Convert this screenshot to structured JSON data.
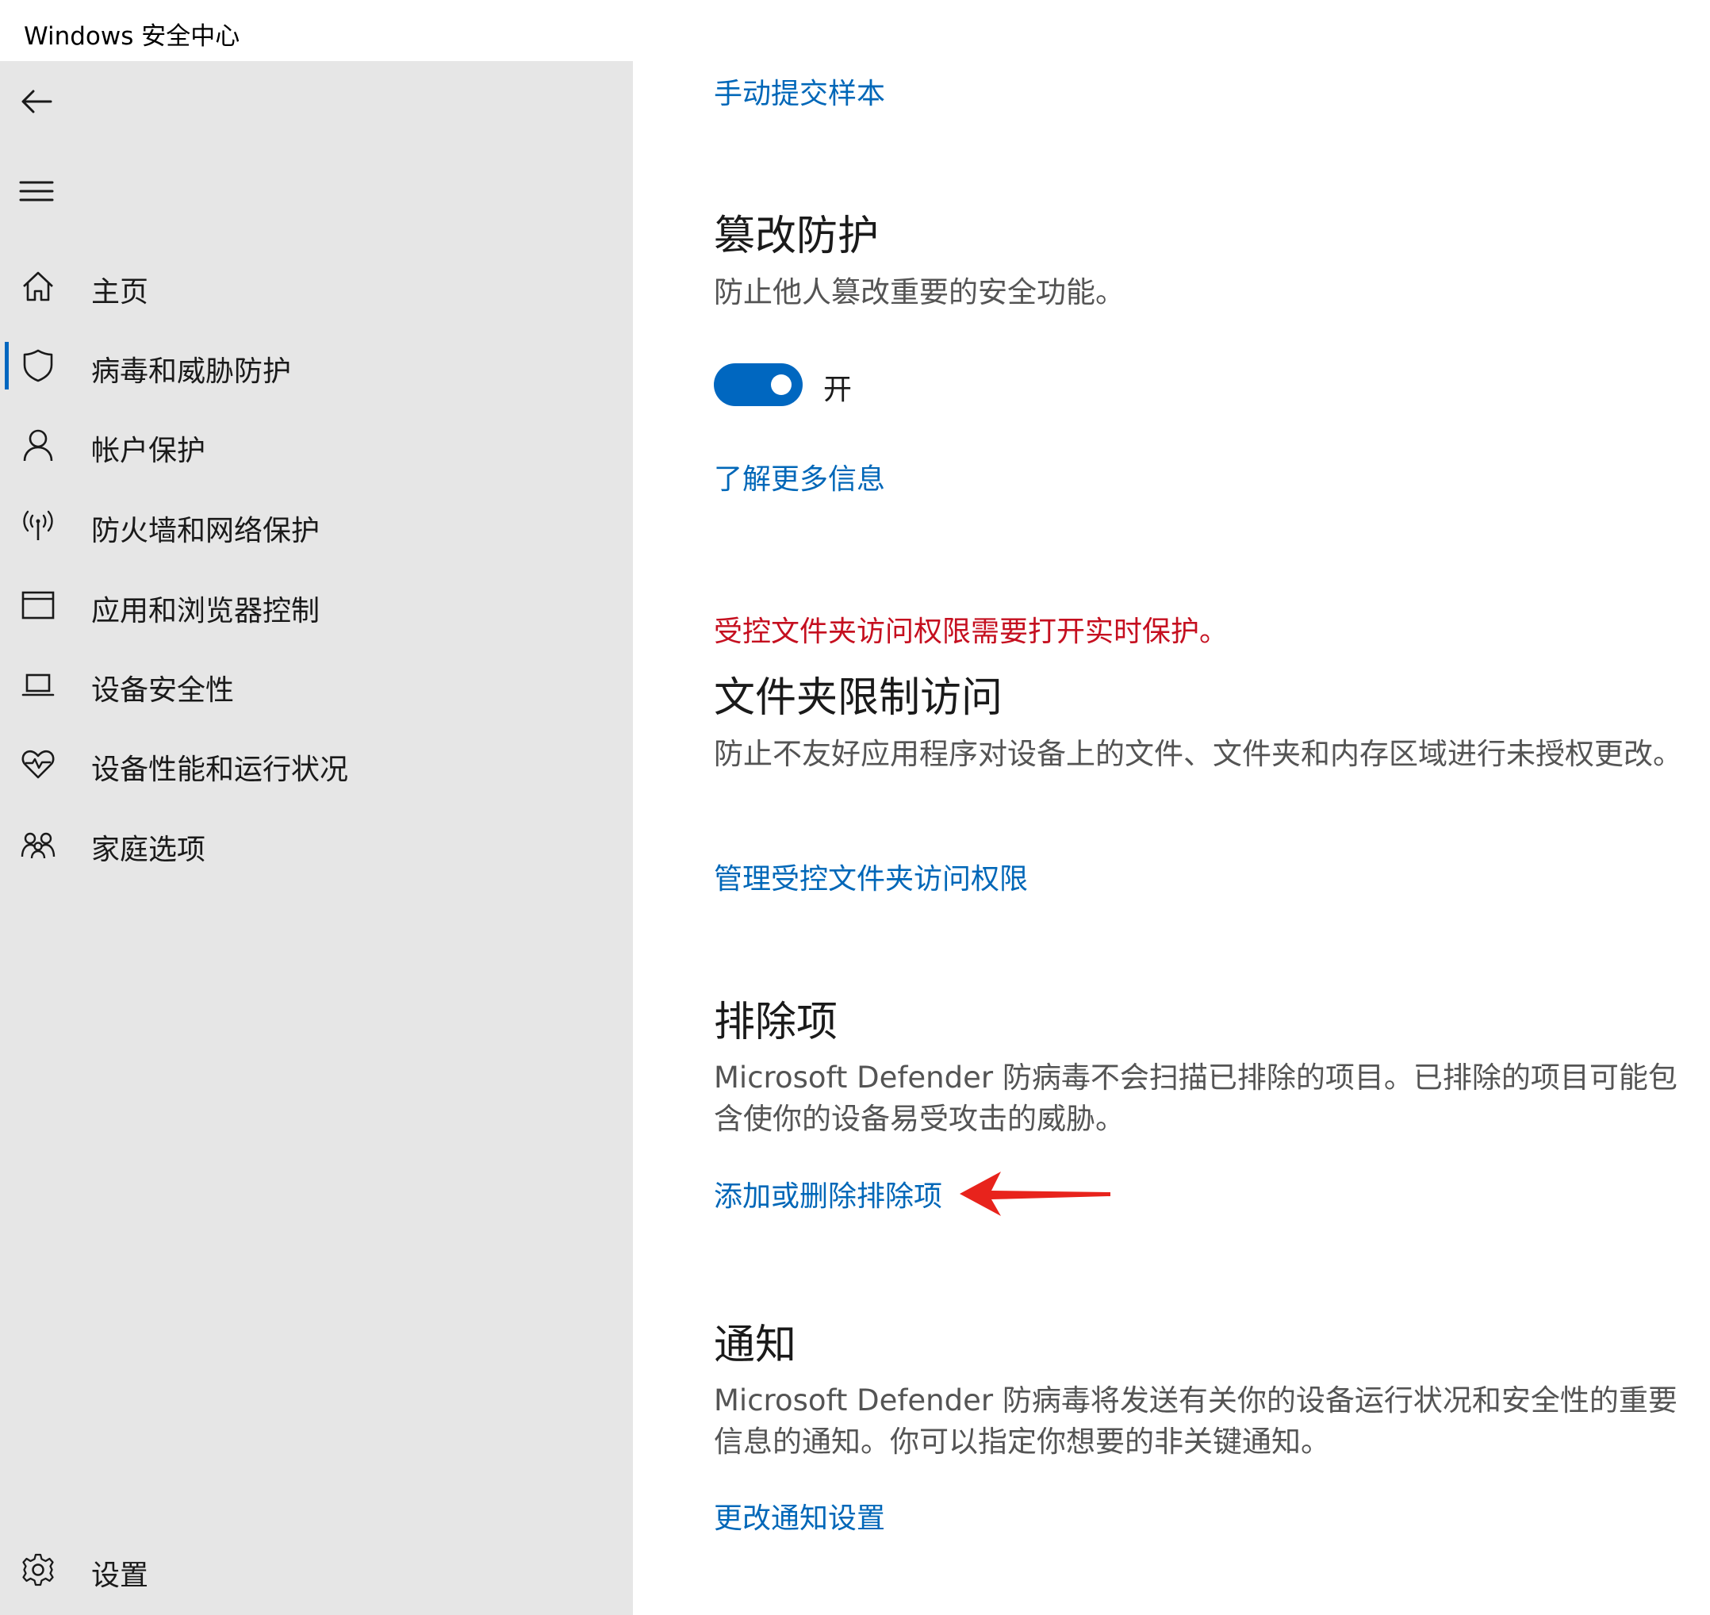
{
  "window": {
    "title": "Windows 安全中心"
  },
  "sidebar": {
    "back_icon": "arrow-left-icon",
    "menu_icon": "hamburger-icon",
    "items": [
      {
        "label": "主页",
        "icon": "home-icon",
        "selected": false
      },
      {
        "label": "病毒和威胁防护",
        "icon": "shield-icon",
        "selected": true
      },
      {
        "label": "帐户保护",
        "icon": "person-icon",
        "selected": false
      },
      {
        "label": "防火墙和网络保护",
        "icon": "wireless-icon",
        "selected": false
      },
      {
        "label": "应用和浏览器控制",
        "icon": "app-window-icon",
        "selected": false
      },
      {
        "label": "设备安全性",
        "icon": "laptop-icon",
        "selected": false
      },
      {
        "label": "设备性能和运行状况",
        "icon": "heart-icon",
        "selected": false
      },
      {
        "label": "家庭选项",
        "icon": "family-icon",
        "selected": false
      }
    ],
    "settings": {
      "label": "设置",
      "icon": "gear-icon"
    }
  },
  "main": {
    "submit_sample_link": "手动提交样本",
    "tamper": {
      "title": "篡改防护",
      "description": "防止他人篡改重要的安全功能。",
      "toggle_on": true,
      "toggle_label": "开",
      "learn_more_link": "了解更多信息"
    },
    "folder_access": {
      "warning": "受控文件夹访问权限需要打开实时保护。",
      "title": "文件夹限制访问",
      "description": "防止不友好应用程序对设备上的文件、文件夹和内存区域进行未授权更改。",
      "manage_link": "管理受控文件夹访问权限"
    },
    "exclusions": {
      "title": "排除项",
      "description": "Microsoft Defender 防病毒不会扫描已排除的项目。已排除的项目可能包含使你的设备易受攻击的威胁。",
      "link": "添加或删除排除项"
    },
    "notifications": {
      "title": "通知",
      "description": "Microsoft Defender 防病毒将发送有关你的设备运行状况和安全性的重要信息的通知。你可以指定你想要的非关键通知。",
      "link": "更改通知设置"
    }
  },
  "colors": {
    "accent": "#0067c0",
    "link": "#0067b8",
    "warning": "#c50f1f",
    "sidebar_bg": "#e6e6e6",
    "annotation_arrow": "#e8231c"
  }
}
